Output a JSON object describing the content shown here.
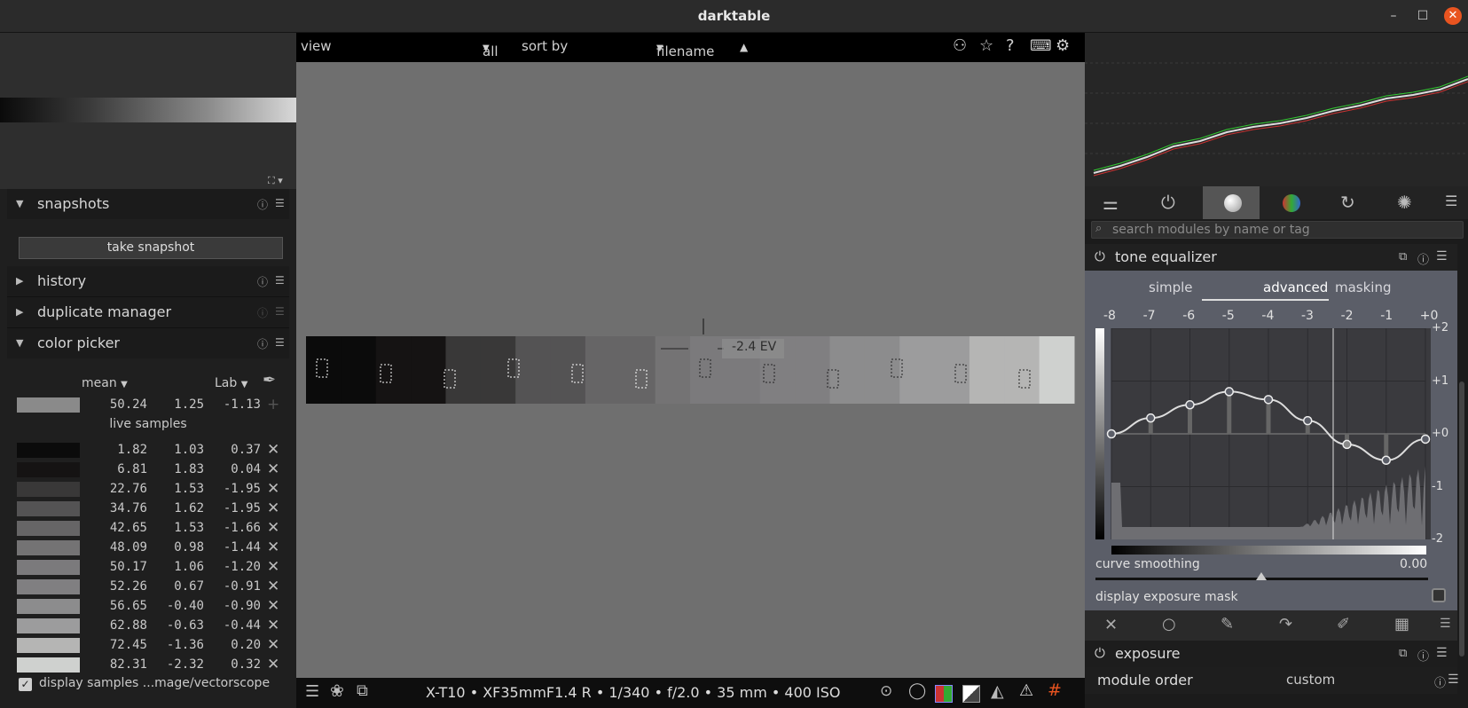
{
  "window": {
    "title": "darktable"
  },
  "top_filter": {
    "view": "view",
    "collection": "all",
    "sort_by_label": "sort by",
    "sort_by": "filename"
  },
  "left": {
    "sections": {
      "snapshots": "snapshots",
      "take_snapshot": "take snapshot",
      "history": "history",
      "duplicate": "duplicate manager",
      "color_picker": "color picker"
    },
    "color_picker": {
      "mode": "mean",
      "space": "Lab",
      "primary": {
        "color": "#8a8a8a",
        "v": [
          "50.24",
          "1.25",
          "-1.13"
        ]
      },
      "live_label": "live samples",
      "samples": [
        {
          "color": "#0b0b0b",
          "v": [
            "1.82",
            "1.03",
            "0.37"
          ]
        },
        {
          "color": "#151313",
          "v": [
            "6.81",
            "1.83",
            "0.04"
          ]
        },
        {
          "color": "#393838",
          "v": [
            "22.76",
            "1.53",
            "-1.95"
          ]
        },
        {
          "color": "#545354",
          "v": [
            "34.76",
            "1.62",
            "-1.95"
          ]
        },
        {
          "color": "#666566",
          "v": [
            "42.65",
            "1.53",
            "-1.66"
          ]
        },
        {
          "color": "#747374",
          "v": [
            "48.09",
            "0.98",
            "-1.44"
          ]
        },
        {
          "color": "#7b7a7c",
          "v": [
            "50.17",
            "1.06",
            "-1.20"
          ]
        },
        {
          "color": "#807f81",
          "v": [
            "52.26",
            "0.67",
            "-0.91"
          ]
        },
        {
          "color": "#8c8c8d",
          "v": [
            "56.65",
            "-0.40",
            "-0.90"
          ]
        },
        {
          "color": "#9c9c9d",
          "v": [
            "62.88",
            "-0.63",
            "-0.44"
          ]
        },
        {
          "color": "#b5b5b4",
          "v": [
            "72.45",
            "-1.36",
            "0.20"
          ]
        },
        {
          "color": "#cfd1cf",
          "v": [
            "82.31",
            "-2.32",
            "0.32"
          ]
        }
      ],
      "display_samples_label": "display samples ...mage/vectorscope"
    }
  },
  "center": {
    "ev_label": "-2.4 EV",
    "image_info": "X-T10 • XF35mmF1.4 R • 1/340 • f/2.0 • 35 mm • 400 ISO"
  },
  "right": {
    "search_placeholder": "search modules by name or tag",
    "tone_equalizer": {
      "title": "tone equalizer",
      "tabs": [
        "simple",
        "advanced",
        "masking"
      ],
      "active_tab": "advanced",
      "ev_ticks": [
        "-8",
        "-7",
        "-6",
        "-5",
        "-4",
        "-3",
        "-2",
        "-1",
        "+0"
      ],
      "y_ticks": [
        "+2",
        "+1",
        "+0",
        "-1",
        "-2"
      ],
      "node_values_ev": [
        0.0,
        0.3,
        0.55,
        0.8,
        0.65,
        0.25,
        -0.2,
        -0.5,
        -0.1
      ],
      "curve_smoothing_label": "curve smoothing",
      "curve_smoothing_value": "0.00",
      "exposure_mask_label": "display exposure mask"
    },
    "exposure": {
      "title": "exposure"
    },
    "module_order": {
      "label": "module order",
      "value": "custom"
    }
  }
}
